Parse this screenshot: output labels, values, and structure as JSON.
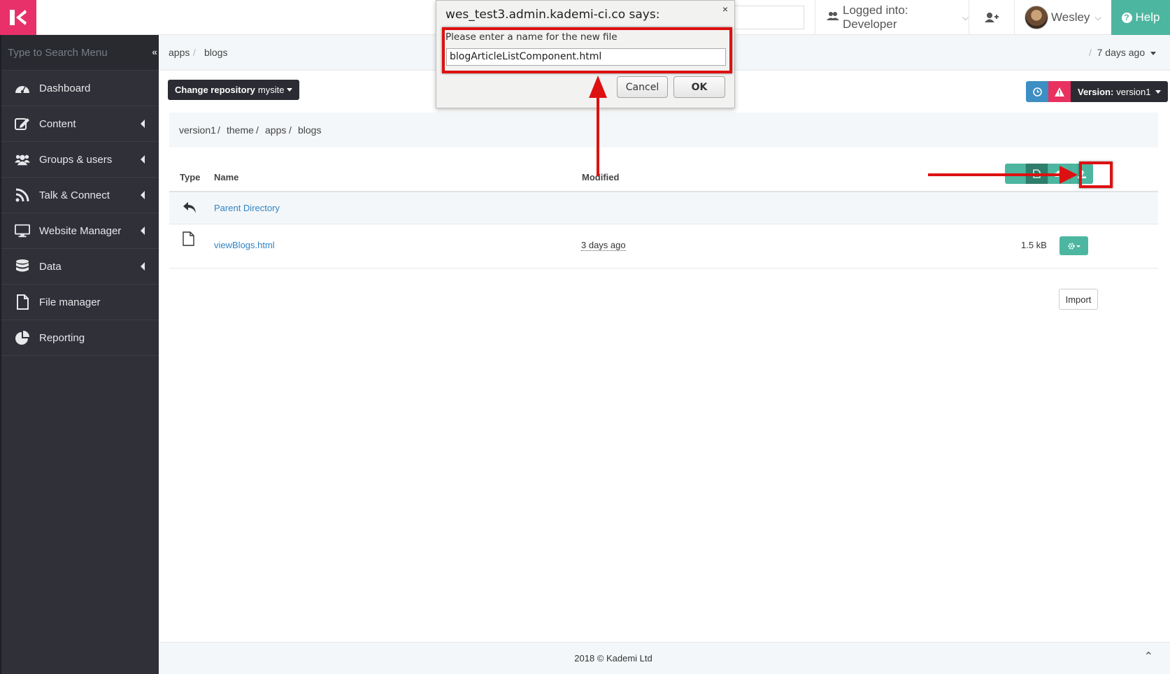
{
  "topbar": {
    "logged_into": "Logged into: Developer",
    "user_name": "Wesley",
    "help_label": "Help"
  },
  "sidebar": {
    "search_placeholder": "Type to Search Menu",
    "collapse_glyph": "«",
    "items": [
      {
        "label": "Dashboard",
        "icon": "dashboard-icon",
        "has_submenu": false
      },
      {
        "label": "Content",
        "icon": "edit-icon",
        "has_submenu": true
      },
      {
        "label": "Groups & users",
        "icon": "users-icon",
        "has_submenu": true
      },
      {
        "label": "Talk & Connect",
        "icon": "rss-icon",
        "has_submenu": true
      },
      {
        "label": "Website Manager",
        "icon": "monitor-icon",
        "has_submenu": true
      },
      {
        "label": "Data",
        "icon": "database-icon",
        "has_submenu": true
      },
      {
        "label": "File manager",
        "icon": "file-icon",
        "has_submenu": false
      },
      {
        "label": "Reporting",
        "icon": "pie-chart-icon",
        "has_submenu": false
      }
    ]
  },
  "breadcrumb": {
    "items": [
      "apps",
      "blogs"
    ],
    "separator": "/",
    "modified_ago": "7 days ago"
  },
  "toolbar": {
    "change_repo_label": "Change repository",
    "repo_name": "mysite",
    "version_label": "Version:",
    "version_value": "version1"
  },
  "path": {
    "items": [
      "version1",
      "theme",
      "apps",
      "blogs"
    ]
  },
  "table": {
    "headers": {
      "type": "Type",
      "name": "Name",
      "modified": "Modified"
    },
    "parent_label": "Parent Directory",
    "files": [
      {
        "name": "viewBlogs.html",
        "modified": "3 days ago",
        "size": "1.5 kB"
      }
    ]
  },
  "import_label": "Import",
  "footer": {
    "text": "2018 © Kademi Ltd"
  },
  "dialog": {
    "title": "wes_test3.admin.kademi-ci.co says:",
    "close_glyph": "×",
    "prompt": "Please enter a name for the new file",
    "input_value": "blogArticleListComponent.html",
    "cancel_label": "Cancel",
    "ok_label": "OK"
  },
  "colors": {
    "brand": "#e8316b",
    "accent": "#4db6a0",
    "sidebar_bg": "#2f3038",
    "annotation": "#dd1111"
  }
}
